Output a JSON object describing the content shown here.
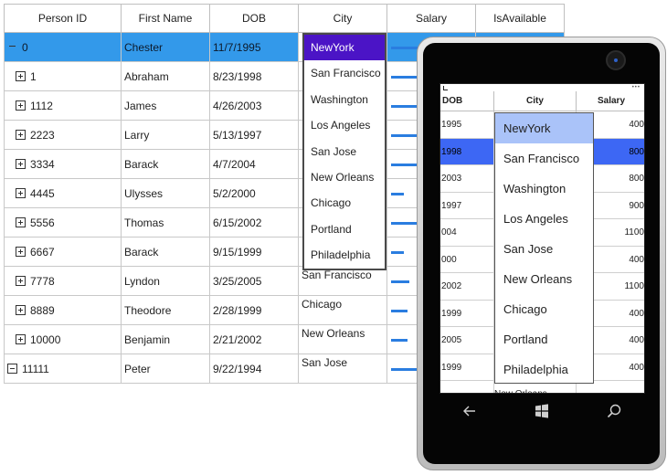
{
  "grid": {
    "columns": [
      "Person ID",
      "First Name",
      "DOB",
      "City",
      "Salary",
      "IsAvailable"
    ],
    "rows": [
      {
        "id": "0",
        "first": "Chester",
        "dob": "11/7/1995",
        "city": "",
        "expander": "minus",
        "selected": true
      },
      {
        "id": "1",
        "first": "Abraham",
        "dob": "8/23/1998",
        "city": "",
        "expander": "plus"
      },
      {
        "id": "1112",
        "first": "James",
        "dob": "4/26/2003",
        "city": "",
        "expander": "plus"
      },
      {
        "id": "2223",
        "first": "Larry",
        "dob": "5/13/1997",
        "city": "",
        "expander": "plus"
      },
      {
        "id": "3334",
        "first": "Barack",
        "dob": "4/7/2004",
        "city": "",
        "expander": "plus"
      },
      {
        "id": "4445",
        "first": "Ulysses",
        "dob": "5/2/2000",
        "city": "",
        "expander": "plus"
      },
      {
        "id": "5556",
        "first": "Thomas",
        "dob": "6/15/2002",
        "city": "",
        "expander": "plus"
      },
      {
        "id": "6667",
        "first": "Barack",
        "dob": "9/15/1999",
        "city": "",
        "expander": "plus"
      },
      {
        "id": "7778",
        "first": "Lyndon",
        "dob": "3/25/2005",
        "city": "San Francisco",
        "expander": "plus"
      },
      {
        "id": "8889",
        "first": "Theodore",
        "dob": "2/28/1999",
        "city": "Chicago",
        "expander": "plus"
      },
      {
        "id": "10000",
        "first": "Benjamin",
        "dob": "2/21/2002",
        "city": "New Orleans",
        "expander": "plus"
      },
      {
        "id": "11111",
        "first": "Peter",
        "dob": "9/22/1994",
        "city": "San Jose",
        "expander": "minus-flat"
      }
    ],
    "city_dropdown": {
      "options": [
        "NewYork",
        "San Francisco",
        "Washington",
        "Los Angeles",
        "San Jose",
        "New Orleans",
        "Chicago",
        "Portland",
        "Philadelphia"
      ],
      "selected": "NewYork"
    },
    "accent_colors": {
      "selected_row": "#3399ea",
      "dropdown_selected": "#4b14c6",
      "salary_bar": "#2a7de0"
    }
  },
  "phone": {
    "columns": [
      "DOB",
      "City",
      "Salary"
    ],
    "rows": [
      {
        "dob": "1995",
        "city": "",
        "salary": "400"
      },
      {
        "dob": "1998",
        "city": "",
        "salary": "800",
        "selected": true
      },
      {
        "dob": "2003",
        "city": "",
        "salary": "800"
      },
      {
        "dob": "1997",
        "city": "",
        "salary": "900"
      },
      {
        "dob": "004",
        "city": "",
        "salary": "1100"
      },
      {
        "dob": "000",
        "city": "",
        "salary": "400"
      },
      {
        "dob": "2002",
        "city": "",
        "salary": "1100"
      },
      {
        "dob": "1999",
        "city": "",
        "salary": "400"
      },
      {
        "dob": "2005",
        "city": "",
        "salary": "400"
      },
      {
        "dob": "1999",
        "city": "",
        "salary": "400"
      },
      {
        "dob": "",
        "city": "New Orleans",
        "salary": ""
      }
    ],
    "city_dropdown": {
      "options": [
        "NewYork",
        "San Francisco",
        "Washington",
        "Los Angeles",
        "San Jose",
        "New Orleans",
        "Chicago",
        "Portland",
        "Philadelphia"
      ],
      "selected": "NewYork"
    },
    "nav_icons": [
      "back-arrow-icon",
      "windows-start-icon",
      "search-icon"
    ],
    "accent_colors": {
      "selected_row": "#3d67f4",
      "dropdown_selected": "#aac3f9"
    }
  }
}
